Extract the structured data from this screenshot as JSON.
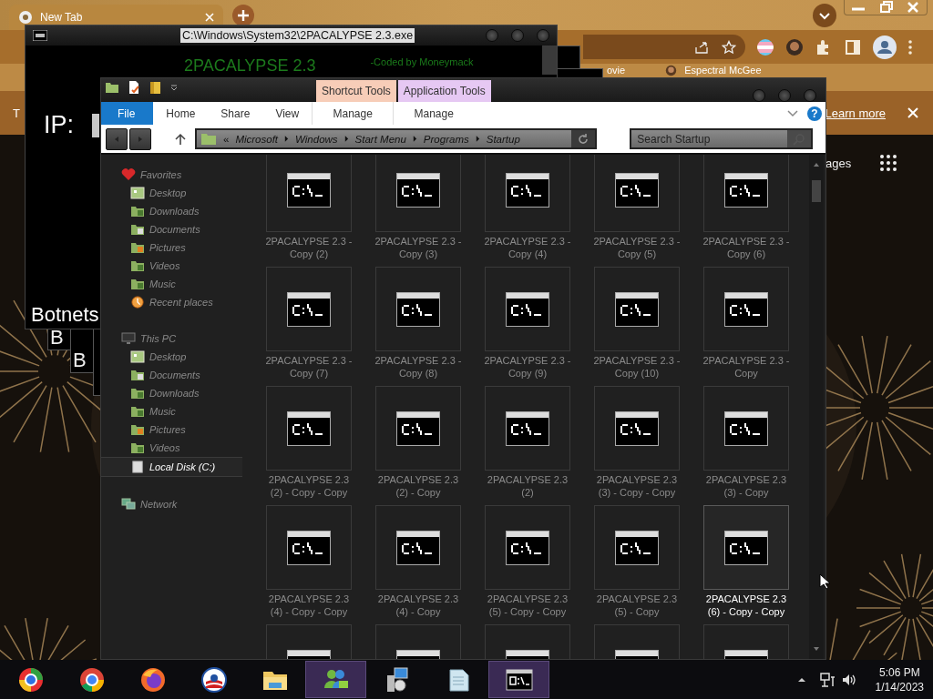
{
  "browser": {
    "tab": {
      "title": "New Tab",
      "selected": true
    },
    "bookmarks": [
      {
        "label": "ovie",
        "kind": "plain"
      },
      {
        "label": "Espectral McGee",
        "kind": "avatar"
      }
    ],
    "info_bar": {
      "text": "T",
      "link": "Learn more"
    },
    "page_link": "ages"
  },
  "console": {
    "title": "C:\\Windows\\System32\\2PACALYPSE 2.3.exe",
    "banner": "2PACALYPSE 2.3",
    "credit": "-Coded by Moneymack",
    "ip_label": "IP:",
    "section": "Botnets",
    "stacked_windows": [
      {
        "kind": "labeled",
        "text": "B"
      },
      {
        "kind": "labeled",
        "text": "B"
      },
      {
        "kind": "blank"
      }
    ]
  },
  "explorer": {
    "contextual_tabs": [
      {
        "label": "Shortcut Tools",
        "color": "#f7cdb8",
        "tab": "Manage"
      },
      {
        "label": "Application Tools",
        "color": "#e6c8f3",
        "tab": "Manage"
      }
    ],
    "ribbon_tabs": [
      {
        "label": "File",
        "kind": "menu"
      },
      {
        "label": "Home",
        "kind": "tab"
      },
      {
        "label": "Share",
        "kind": "tab"
      },
      {
        "label": "View",
        "kind": "tab"
      }
    ],
    "help": "?",
    "breadcrumb": {
      "overflow": "«",
      "parts": [
        "Microsoft",
        "Windows",
        "Start Menu",
        "Programs",
        "Startup"
      ]
    },
    "search": {
      "placeholder": "Search Startup"
    },
    "nav": [
      {
        "label": "Favorites",
        "kind": "favorites",
        "children": [
          {
            "label": "Desktop",
            "kind": "desktop",
            "selected": false
          },
          {
            "label": "Downloads",
            "kind": "downloads",
            "selected": false
          },
          {
            "label": "Documents",
            "kind": "documents",
            "selected": false
          },
          {
            "label": "Pictures",
            "kind": "pictures",
            "selected": false
          },
          {
            "label": "Videos",
            "kind": "videos",
            "selected": false
          },
          {
            "label": "Music",
            "kind": "music",
            "selected": false
          },
          {
            "label": "Recent places",
            "kind": "recent",
            "selected": false
          }
        ]
      },
      {
        "label": "This PC",
        "kind": "pc",
        "children": [
          {
            "label": "Desktop",
            "kind": "desktop",
            "selected": false
          },
          {
            "label": "Documents",
            "kind": "documents",
            "selected": false
          },
          {
            "label": "Downloads",
            "kind": "downloads",
            "selected": false
          },
          {
            "label": "Music",
            "kind": "music",
            "selected": false
          },
          {
            "label": "Pictures",
            "kind": "pictures",
            "selected": false
          },
          {
            "label": "Videos",
            "kind": "videos",
            "selected": false
          },
          {
            "label": "Local Disk (C:)",
            "kind": "disk",
            "selected": true
          }
        ]
      },
      {
        "label": "Network",
        "kind": "network"
      }
    ],
    "files": [
      {
        "label": "2PACALYPSE 2.3 - Copy (2)",
        "selected": false
      },
      {
        "label": "2PACALYPSE 2.3 - Copy (3)",
        "selected": false
      },
      {
        "label": "2PACALYPSE 2.3 - Copy (4)",
        "selected": false
      },
      {
        "label": "2PACALYPSE 2.3 - Copy (5)",
        "selected": false
      },
      {
        "label": "2PACALYPSE 2.3 - Copy (6)",
        "selected": false
      },
      {
        "label": "2PACALYPSE 2.3 - Copy (7)",
        "selected": false
      },
      {
        "label": "2PACALYPSE 2.3 - Copy (8)",
        "selected": false
      },
      {
        "label": "2PACALYPSE 2.3 - Copy (9)",
        "selected": false
      },
      {
        "label": "2PACALYPSE 2.3 - Copy (10)",
        "selected": false
      },
      {
        "label": "2PACALYPSE 2.3 - Copy",
        "selected": false
      },
      {
        "label": "2PACALYPSE 2.3 (2) - Copy - Copy",
        "selected": false
      },
      {
        "label": "2PACALYPSE 2.3 (2) - Copy",
        "selected": false
      },
      {
        "label": "2PACALYPSE 2.3 (2)",
        "selected": false
      },
      {
        "label": "2PACALYPSE 2.3 (3) - Copy - Copy",
        "selected": false
      },
      {
        "label": "2PACALYPSE 2.3 (3) - Copy",
        "selected": false
      },
      {
        "label": "2PACALYPSE 2.3 (4) - Copy - Copy",
        "selected": false
      },
      {
        "label": "2PACALYPSE 2.3 (4) - Copy",
        "selected": false
      },
      {
        "label": "2PACALYPSE 2.3 (5) - Copy - Copy",
        "selected": false
      },
      {
        "label": "2PACALYPSE 2.3 (5) - Copy",
        "selected": false
      },
      {
        "label": "2PACALYPSE 2.3 (6) - Copy - Copy",
        "selected": true
      },
      {
        "selected": false
      },
      {
        "selected": false
      },
      {
        "selected": false
      },
      {
        "selected": false
      },
      {
        "selected": false
      }
    ]
  },
  "taskbar": {
    "apps": [
      {
        "kind": "orb",
        "active": false
      },
      {
        "kind": "chrome",
        "active": false
      },
      {
        "kind": "firefox",
        "active": false
      },
      {
        "kind": "sunrise",
        "active": false
      },
      {
        "kind": "folder",
        "active": false
      },
      {
        "kind": "people",
        "active": true
      },
      {
        "kind": "installer",
        "active": false
      },
      {
        "kind": "notepad",
        "active": false
      },
      {
        "kind": "console",
        "active": true
      }
    ],
    "time": "5:06 PM",
    "date": "1/14/2023"
  }
}
